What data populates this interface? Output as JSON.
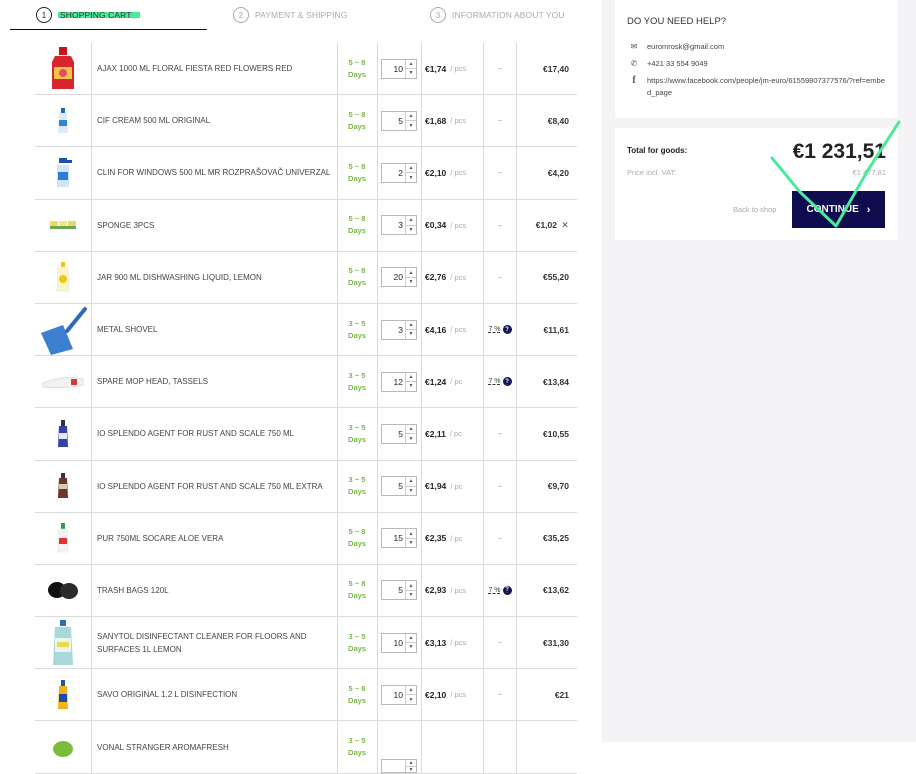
{
  "steps": [
    {
      "num": "1",
      "label": "SHOPPING CART"
    },
    {
      "num": "2",
      "label": "PAYMENT & SHIPPING"
    },
    {
      "num": "3",
      "label": "INFORMATION ABOUT YOU"
    }
  ],
  "days_unit": "Days",
  "items": [
    {
      "name": "AJAX 1000 ML FLORAL FIESTA RED FLOWERS RED",
      "days": "5 ~ 8",
      "qty": "10",
      "price": "€1,74",
      "unit": "/ pcs",
      "discount": "–",
      "total": "€17,40",
      "icon": "red-bottle"
    },
    {
      "name": "CIF CREAM 500 ML ORIGINAL",
      "days": "5 ~ 8",
      "qty": "5",
      "price": "€1,68",
      "unit": "/ pcs",
      "discount": "–",
      "total": "€8,40",
      "icon": "cream-bottle"
    },
    {
      "name": "CLIN FOR WINDOWS 500 ML MR ROZPRAŠOVAČ UNIVERZAL",
      "days": "5 ~ 8",
      "qty": "2",
      "price": "€2,10",
      "unit": "/ pcs",
      "discount": "–",
      "total": "€4,20",
      "icon": "spray-bottle"
    },
    {
      "name": "SPONGE 3PCS",
      "days": "5 ~ 8",
      "qty": "3",
      "price": "€0,34",
      "unit": "/ pcs",
      "discount": "–",
      "total": "€1,02",
      "icon": "sponge",
      "remove": "✕"
    },
    {
      "name": "JAR 900 ML DISHWASHING LIQUID, LEMON",
      "days": "5 ~ 8",
      "qty": "20",
      "price": "€2,76",
      "unit": "/ pcs",
      "discount": "–",
      "total": "€55,20",
      "icon": "dish-bottle"
    },
    {
      "name": "METAL SHOVEL",
      "days": "3 ~ 5",
      "qty": "3",
      "price": "€4,16",
      "unit": "/ pcs",
      "discount": "7 %",
      "total": "€11,61",
      "icon": "shovel"
    },
    {
      "name": "SPARE MOP HEAD, TASSELS",
      "days": "3 ~ 5",
      "qty": "12",
      "price": "€1,24",
      "unit": "/ pc",
      "discount": "7 %",
      "total": "€13,84",
      "icon": "mop"
    },
    {
      "name": "IO SPLENDO AGENT FOR RUST AND SCALE 750 ML",
      "days": "3 ~ 5",
      "qty": "5",
      "price": "€2,11",
      "unit": "/ pc",
      "discount": "–",
      "total": "€10,55",
      "icon": "blue-bottle"
    },
    {
      "name": "IO SPLENDO AGENT FOR RUST AND SCALE 750 ML EXTRA",
      "days": "3 ~ 5",
      "qty": "5",
      "price": "€1,94",
      "unit": "/ pc",
      "discount": "–",
      "total": "€9,70",
      "icon": "brown-bottle"
    },
    {
      "name": "PUR 750ML SOCARE ALOE VERA",
      "days": "5 ~ 8",
      "qty": "15",
      "price": "€2,35",
      "unit": "/ pc",
      "discount": "–",
      "total": "€35,25",
      "icon": "white-bottle"
    },
    {
      "name": "TRASH BAGS 120L",
      "days": "5 ~ 8",
      "qty": "5",
      "price": "€2,93",
      "unit": "/ pcs",
      "discount": "7 %",
      "total": "€13,62",
      "icon": "trash-bags"
    },
    {
      "name": "SANYTOL DISINFECTANT CLEANER FOR FLOORS AND SURFACES 1L LEMON",
      "days": "3 ~ 5",
      "qty": "10",
      "price": "€3,13",
      "unit": "/ pcs",
      "discount": "–",
      "total": "€31,30",
      "icon": "large-bottle"
    },
    {
      "name": "SAVO ORIGINAL 1.2 L DISINFECTION",
      "days": "5 ~ 8",
      "qty": "10",
      "price": "€2,10",
      "unit": "/ pcs",
      "discount": "–",
      "total": "€21",
      "icon": "yellow-bottle"
    },
    {
      "name": "VONAL STRANGER AROMAFRESH",
      "days": "3 ~ 5",
      "qty": "",
      "price": "",
      "unit": "",
      "discount": "",
      "total": "",
      "icon": "green-bottle"
    }
  ],
  "help": {
    "title": "DO YOU NEED HELP?",
    "email": "euromrosk@gmail.com",
    "phone": "+421 33 554 9049",
    "facebook": "https://www.facebook.com/people/jm-euro/61559807377576/?ref=embed_page"
  },
  "summary": {
    "total_label": "Total for goods:",
    "total": "€1 231,51",
    "vat_label": "Price incl. VAT:",
    "vat": "€1 477,81",
    "back": "Back to shop",
    "continue": "CONTINUE"
  },
  "colors": {
    "accent": "#0f0c4f",
    "highlight": "#4bea9a",
    "days": "#7ab648"
  }
}
